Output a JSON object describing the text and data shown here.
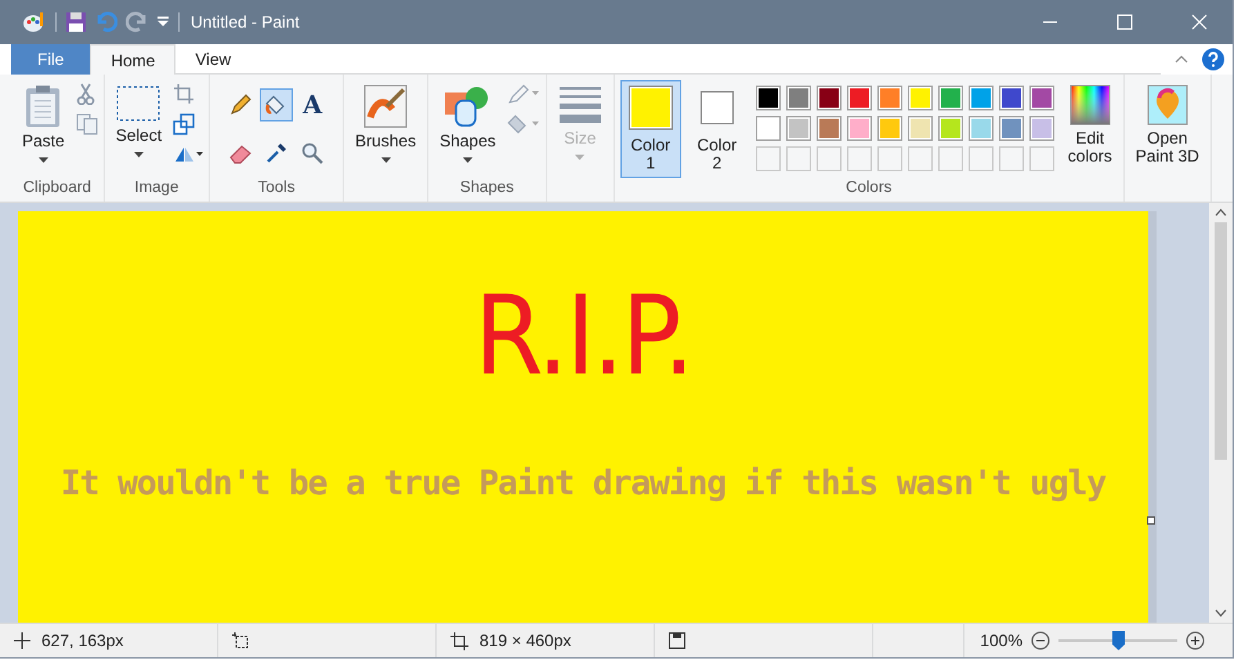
{
  "window": {
    "title": "Untitled - Paint"
  },
  "tabs": [
    {
      "label": "File",
      "kind": "file",
      "selected": false
    },
    {
      "label": "Home",
      "kind": "tab",
      "selected": true
    },
    {
      "label": "View",
      "kind": "tab",
      "selected": false
    }
  ],
  "ribbon": {
    "clipboard": {
      "label": "Clipboard",
      "paste": "Paste"
    },
    "image": {
      "label": "Image",
      "select": "Select"
    },
    "tools": {
      "label": "Tools",
      "items": [
        {
          "kind": "pencil",
          "selected": false
        },
        {
          "kind": "fill",
          "selected": true
        },
        {
          "kind": "text",
          "label": "A",
          "selected": false
        },
        {
          "kind": "eraser",
          "selected": false
        },
        {
          "kind": "picker",
          "selected": false
        },
        {
          "kind": "magnifier",
          "selected": false
        }
      ]
    },
    "brushes": "Brushes",
    "shapes": {
      "label": "Shapes",
      "button": "Shapes"
    },
    "size": {
      "label": "Size",
      "disabled": true
    },
    "colors": {
      "label": "Colors",
      "color1": {
        "line1": "Color",
        "line2": "1",
        "color": "#fff200",
        "selected": true
      },
      "color2": {
        "line1": "Color",
        "line2": "2",
        "color": "#ffffff",
        "selected": false
      },
      "palette": [
        {
          "color": "#000000"
        },
        {
          "color": "#7f7f7f"
        },
        {
          "color": "#880015"
        },
        {
          "color": "#ed1c24"
        },
        {
          "color": "#ff7f27"
        },
        {
          "color": "#fff200"
        },
        {
          "color": "#22b14c"
        },
        {
          "color": "#00a2e8"
        },
        {
          "color": "#3f48cc"
        },
        {
          "color": "#a349a4"
        },
        {
          "color": "#ffffff"
        },
        {
          "color": "#c3c3c3"
        },
        {
          "color": "#b97a57"
        },
        {
          "color": "#ffaec9"
        },
        {
          "color": "#ffc90e"
        },
        {
          "color": "#efe4b0"
        },
        {
          "color": "#b5e61d"
        },
        {
          "color": "#99d9ea"
        },
        {
          "color": "#7092be"
        },
        {
          "color": "#c8bfe7"
        }
      ],
      "edit": {
        "line1": "Edit",
        "line2": "colors"
      }
    },
    "paint3d": {
      "line1": "Open",
      "line2": "Paint 3D"
    }
  },
  "canvas": {
    "handwriting": "R.I.P.",
    "caption": "It wouldn't be a true Paint drawing if this wasn't ugly"
  },
  "status_bar": {
    "position": "627, 163px",
    "size": "819 × 460px",
    "zoom": "100%",
    "level": 0.5
  }
}
